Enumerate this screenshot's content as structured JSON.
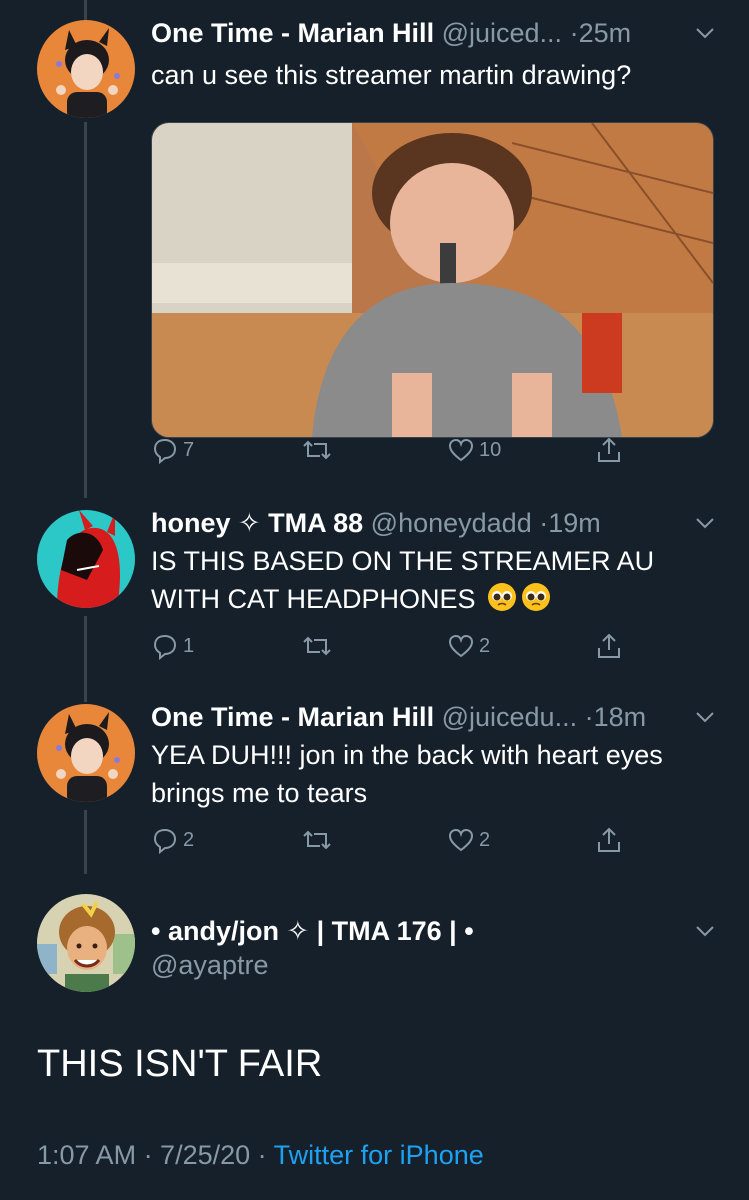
{
  "tweets": [
    {
      "name": "One Time - Marian Hill",
      "handle": "@juiced...",
      "time": "·25m",
      "text": "can u see this streamer martin drawing?",
      "replies": "7",
      "retweets": "",
      "likes": "10"
    },
    {
      "name": "honey ✧ TMA 88",
      "handle": "@honeydadd",
      "time": "·19m",
      "text": "IS THIS BASED ON THE STREAMER AU WITH CAT HEADPHONES",
      "replies": "1",
      "retweets": "",
      "likes": "2"
    },
    {
      "name": "One Time - Marian Hill",
      "handle": "@juicedu...",
      "time": "·18m",
      "text": "YEA DUH!!! jon in the back with heart eyes brings me to tears",
      "replies": "2",
      "retweets": "",
      "likes": "2"
    }
  ],
  "main_tweet": {
    "name": "• andy/jon ✧ | TMA 176 | •",
    "handle": "@ayaptre",
    "text": "THIS ISN'T FAIR",
    "timestamp": "1:07 AM · 7/25/20 · ",
    "source": "Twitter for iPhone"
  },
  "colors": {
    "background": "#15202b",
    "secondary_text": "#8899a6",
    "link": "#1da1f2",
    "divider": "#38444d"
  },
  "icons": [
    "reply-icon",
    "retweet-icon",
    "like-icon",
    "share-icon",
    "chevron-down-icon"
  ]
}
